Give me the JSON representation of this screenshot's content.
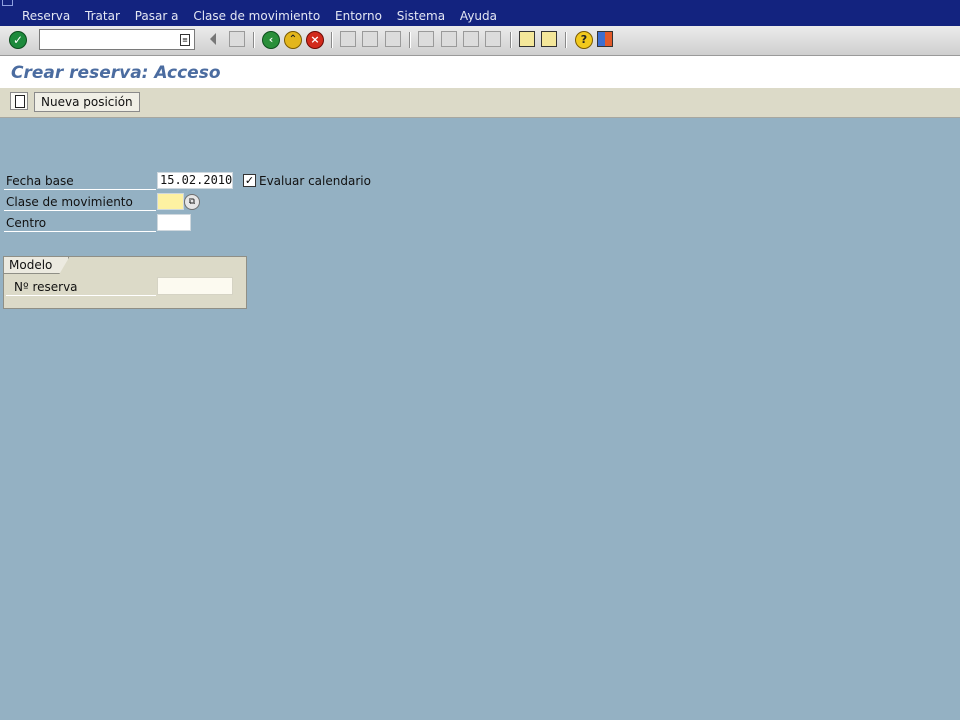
{
  "menu": [
    "Reserva",
    "Tratar",
    "Pasar a",
    "Clase de movimiento",
    "Entorno",
    "Sistema",
    "Ayuda"
  ],
  "command_field": {
    "value": ""
  },
  "title": "Crear reserva: Acceso",
  "app_toolbar": {
    "new_position_label": "Nueva posición"
  },
  "form": {
    "fecha_base_label": "Fecha base",
    "fecha_base_value": "15.02.2010",
    "evaluar_calendario_label": "Evaluar calendario",
    "evaluar_calendario_checked": true,
    "clase_mov_label": "Clase de movimiento",
    "clase_mov_value": "",
    "centro_label": "Centro",
    "centro_value": ""
  },
  "modelo": {
    "tab_label": "Modelo",
    "nreserva_label": "Nº reserva",
    "nreserva_value": ""
  },
  "colors": {
    "menubar": "#13237f",
    "background": "#94b1c3",
    "title": "#4b6ca0"
  }
}
